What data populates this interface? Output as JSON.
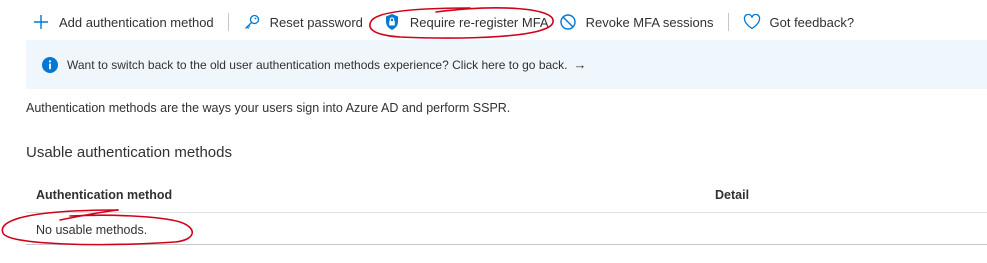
{
  "toolbar": {
    "items": [
      {
        "label": "Add authentication method",
        "icon": "plus-icon"
      },
      {
        "label": "Reset password",
        "icon": "key-icon"
      },
      {
        "label": "Require re-register MFA",
        "icon": "shield-lock-icon"
      },
      {
        "label": "Revoke MFA sessions",
        "icon": "block-icon"
      },
      {
        "label": "Got feedback?",
        "icon": "heart-icon"
      }
    ]
  },
  "info_bar": {
    "text": "Want to switch back to the old user authentication methods experience? Click here to go back.",
    "arrow": "→",
    "icon": "info-icon"
  },
  "description": "Authentication methods are the ways your users sign into Azure AD and perform SSPR.",
  "section_title": "Usable authentication methods",
  "table": {
    "columns": [
      "Authentication method",
      "Detail"
    ],
    "empty_message": "No usable methods."
  },
  "colors": {
    "accent": "#0078d4",
    "info_bg": "#eff6fc",
    "annotation": "#d0021b"
  }
}
